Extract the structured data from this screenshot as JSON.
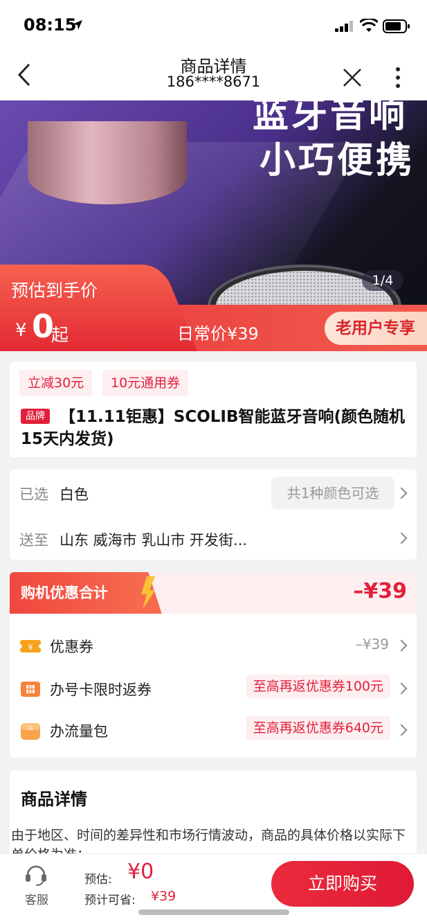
{
  "status_bar": {
    "time": "08:15"
  },
  "nav": {
    "title": "商品详情",
    "subtitle": "186****8671"
  },
  "hero": {
    "headline_1": "蓝牙音响",
    "headline_2": "小巧便携",
    "pager": "1/4",
    "estimate_label": "预估到手价",
    "currency": "¥",
    "estimate_value": "0",
    "estimate_suffix": "起",
    "daily_price": "日常价¥39",
    "old_user": "老用户专享"
  },
  "product": {
    "coupons": [
      "立减30元",
      "10元通用券"
    ],
    "brand_badge": "品牌",
    "title": "【11.11钜惠】SCOLIB智能蓝牙音响(颜色随机15天内发货)"
  },
  "selection": {
    "selected_key": "已选",
    "selected_value": "白色",
    "color_note": "共1种颜色可选",
    "ship_key": "送至",
    "ship_value": "山东 威海市 乳山市 开发街..."
  },
  "discounts": {
    "header": "购机优惠合计",
    "total": "–¥39",
    "rows": [
      {
        "label": "优惠券",
        "value": "–¥39"
      },
      {
        "label": "办号卡限时返券",
        "value": "至高再返优惠券100元"
      },
      {
        "label": "办流量包",
        "value": "至高再返优惠券640元"
      }
    ]
  },
  "details": {
    "title": "商品详情",
    "text": "由于地区、时间的差异性和市场行情波动，商品的具体价格以实际下单价格为准："
  },
  "bottom_bar": {
    "service_label": "客服",
    "estimate_key": "预估:",
    "estimate_value": "¥0",
    "save_key": "预计可省:",
    "save_value": "¥39",
    "buy_label": "立即购买"
  },
  "colors": {
    "accent": "#e1203b",
    "banner": "#e8383a"
  }
}
